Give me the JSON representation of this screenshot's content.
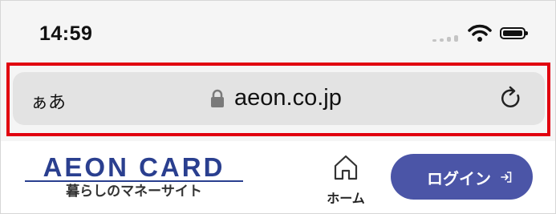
{
  "status_bar": {
    "time": "14:59",
    "icons": [
      "signal-icon",
      "wifi-icon",
      "battery-icon"
    ]
  },
  "address_bar": {
    "text_size_label": "ぁあ",
    "url": "aeon.co.jp",
    "icons": [
      "lock-icon",
      "reload-icon"
    ],
    "highlight_color": "#e1000f"
  },
  "site_header": {
    "logo_text": "AEON CARD",
    "logo_tagline": "暮らしのマネーサイト",
    "home_label": "ホーム",
    "login_label": "ログイン",
    "icons": [
      "home-icon",
      "login-arrow-icon"
    ],
    "brand_color": "#2a3f8f",
    "login_button_color": "#4b55a7"
  }
}
